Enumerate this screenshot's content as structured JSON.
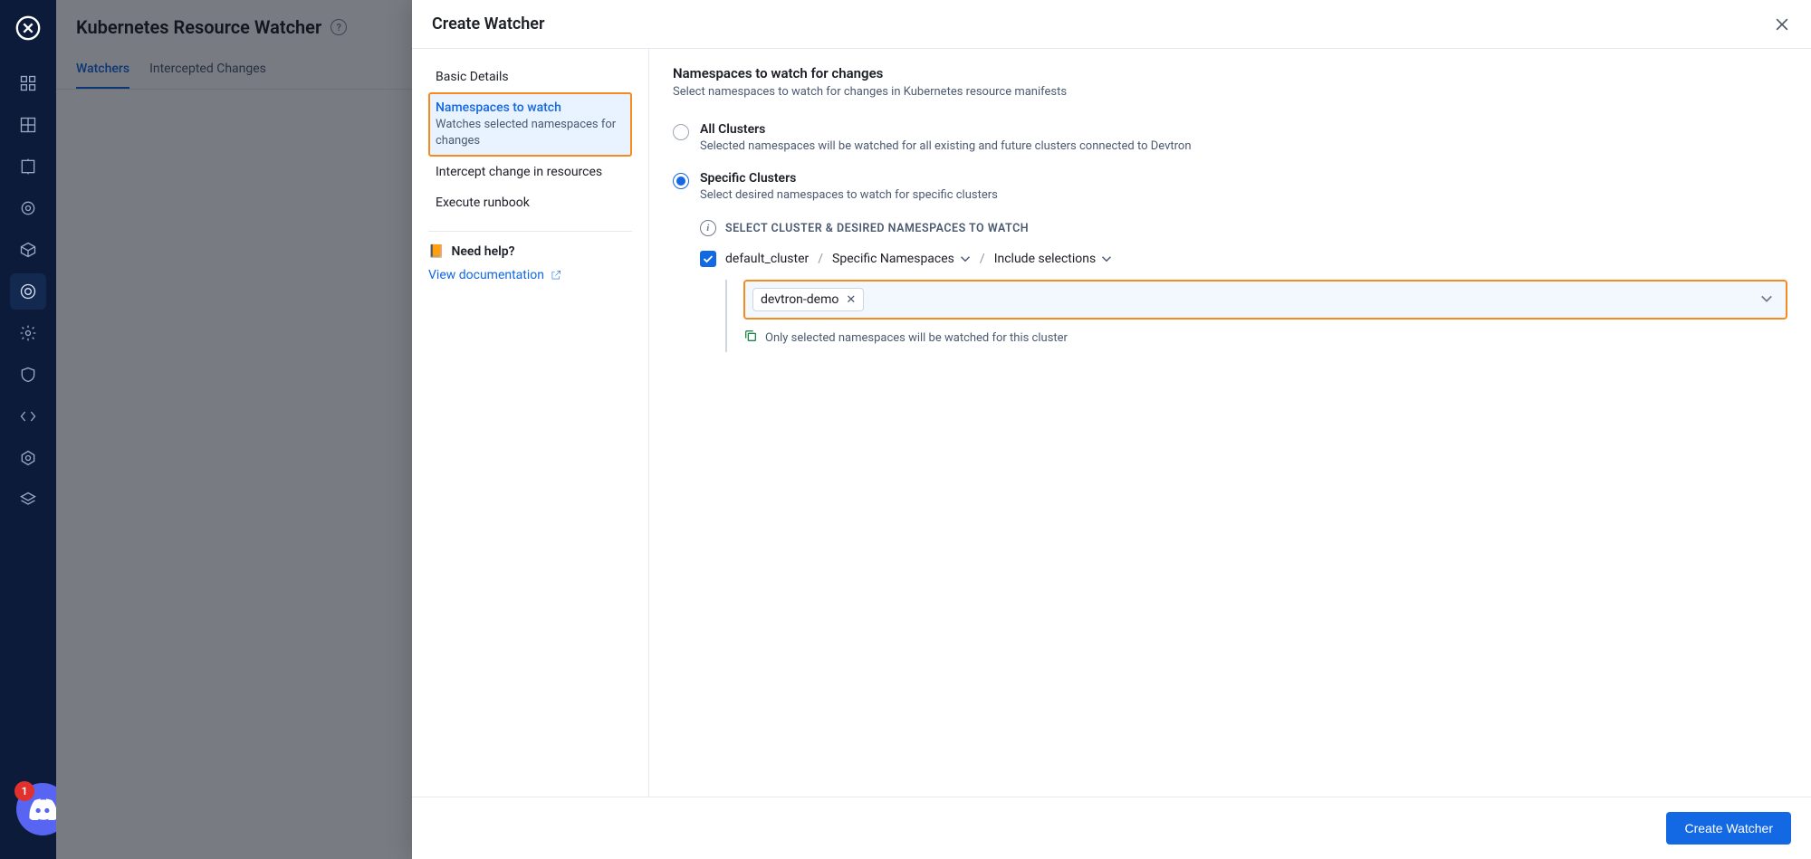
{
  "sidebar_icons": [
    "logo",
    "apps",
    "grid",
    "extension",
    "target",
    "cube",
    "resource-watcher",
    "gear",
    "shield",
    "code",
    "settings-alt",
    "layers"
  ],
  "discord": {
    "count": "1"
  },
  "bg": {
    "title": "Kubernetes Resource Watcher",
    "tabs": [
      "Watchers",
      "Intercepted Changes"
    ],
    "active_tab_index": 0
  },
  "panel": {
    "title": "Create Watcher",
    "side_items": [
      {
        "label": "Basic Details"
      },
      {
        "label": "Namespaces to watch",
        "sub": "Watches selected namespaces for changes",
        "selected": true
      },
      {
        "label": "Intercept change in resources"
      },
      {
        "label": "Execute runbook"
      }
    ],
    "need_help": "Need help?",
    "doc_link": "View documentation",
    "section": {
      "title": "Namespaces to watch for changes",
      "sub": "Select namespaces to watch for changes in Kubernetes resource manifests"
    },
    "radios": [
      {
        "label": "All Clusters",
        "sub": "Selected namespaces will be watched for all existing and future clusters connected to Devtron",
        "checked": false
      },
      {
        "label": "Specific Clusters",
        "sub": "Select desired namespaces to watch for specific clusters",
        "checked": true
      }
    ],
    "instr": "SELECT CLUSTER & DESIRED NAMESPACES TO WATCH",
    "cluster": {
      "checked": true,
      "name": "default_cluster",
      "ns_mode": "Specific Namespaces",
      "include_mode": "Include selections"
    },
    "selected_ns": [
      "devtron-demo"
    ],
    "hint": "Only selected namespaces will be watched for this cluster",
    "footer_btn": "Create Watcher"
  }
}
